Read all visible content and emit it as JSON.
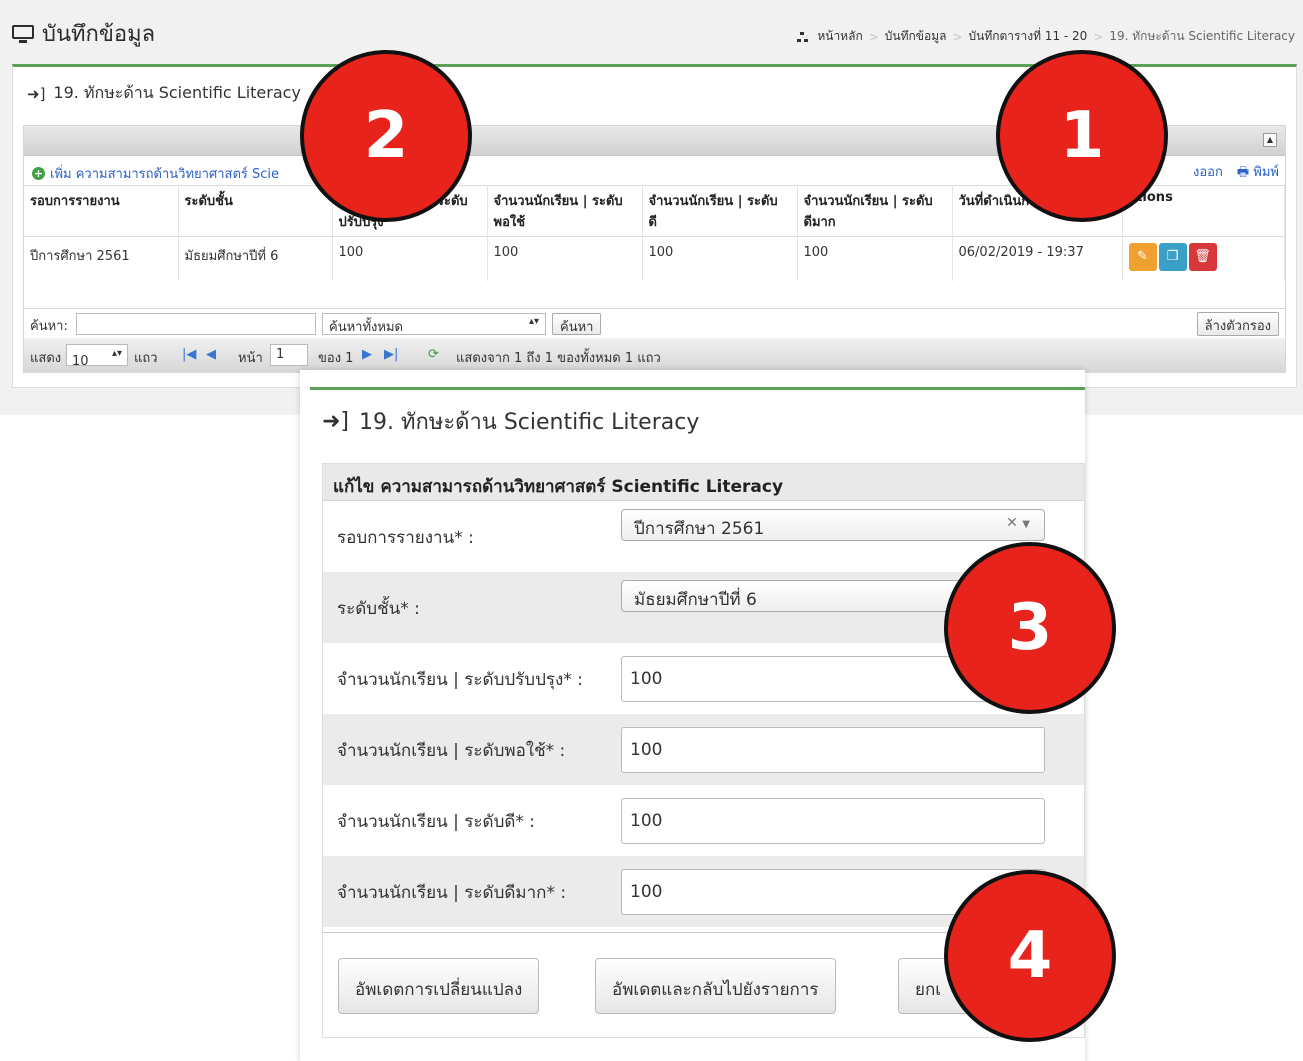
{
  "page": {
    "title": "บันทึกข้อมูล",
    "breadcrumbs": [
      "หน้าหลัก",
      "บันทึกข้อมูล",
      "บันทึกตารางที่ 11 - 20",
      "19. ทักษะด้าน Scientific Literacy"
    ]
  },
  "list": {
    "box_title": "19. ทักษะด้าน Scientific Literacy",
    "add_link": "เพิ่ม ความสามารถด้านวิทยาศาสตร์ Scie",
    "export_label": "งออก",
    "print_label": "พิมพ์",
    "columns": [
      "รอบการรายงาน",
      "ระดับชั้น",
      "จำนวนนักเรียน | ระดับ ปรับปรุง",
      "จำนวนนักเรียน | ระดับ พอใช้",
      "จำนวนนักเรียน | ระดับ ดี",
      "จำนวนนักเรียน | ระดับ ดีมาก",
      "วันที่ดำเนินก",
      "ctions"
    ],
    "rows": [
      {
        "round": "ปีการศึกษา 2561",
        "level": "มัธยมศึกษาปีที่ 6",
        "improve": "100",
        "fair": "100",
        "good": "100",
        "very_good": "100",
        "date": "06/02/2019 - 19:37"
      }
    ],
    "search_label": "ค้นหา:",
    "search_value": "",
    "search_scope": "ค้นหาทั้งหมด",
    "search_button": "ค้นหา",
    "clear_filter": "ล้างตัวกรอง",
    "pager": {
      "show": "แสดง",
      "page_size": "10",
      "rows_unit": "แถว",
      "page_label": "หน้า",
      "page_value": "1",
      "of_pages": "ของ 1",
      "summary": "แสดงจาก 1 ถึง 1 ของทั้งหมด 1 แถว"
    }
  },
  "form": {
    "title": "19. ทักษะด้าน Scientific Literacy",
    "heading": "แก้ไข ความสามารถด้านวิทยาศาสตร์ Scientific Literacy",
    "fields": [
      {
        "label": "รอบการรายงาน* :",
        "value": "ปีการศึกษา 2561"
      },
      {
        "label": "ระดับชั้น* :",
        "value": "มัธยมศึกษาปีที่ 6"
      },
      {
        "label": "จำนวนนักเรียน | ระดับปรับปรุง* :",
        "value": "100"
      },
      {
        "label": "จำนวนนักเรียน | ระดับพอใช้* :",
        "value": "100"
      },
      {
        "label": "จำนวนนักเรียน | ระดับดี* :",
        "value": "100"
      },
      {
        "label": "จำนวนนักเรียน | ระดับดีมาก* :",
        "value": "100"
      }
    ],
    "buttons": {
      "update": "อัพเดตการเปลี่ยนแปลง",
      "update_back": "อัพเดตและกลับไปยังรายการ",
      "cancel": "ยกเ"
    }
  },
  "markers": [
    "1",
    "2",
    "3",
    "4"
  ],
  "colors": {
    "accent_green": "#5aa157",
    "marker_red": "#e8231b",
    "link_blue": "#2a5fc9"
  }
}
